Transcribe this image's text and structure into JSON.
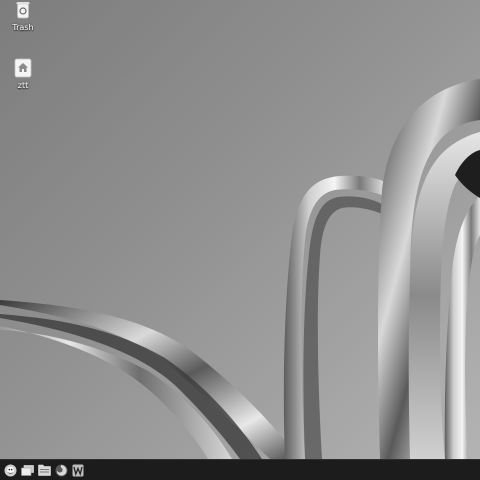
{
  "desktop": {
    "icons": [
      {
        "label": "Trash",
        "icon": "trash-icon"
      },
      {
        "label": "ztt",
        "icon": "home-folder-icon"
      }
    ]
  },
  "taskbar": {
    "buttons": [
      {
        "icon": "start-menu-icon"
      },
      {
        "icon": "show-desktop-icon"
      },
      {
        "icon": "file-manager-icon"
      },
      {
        "icon": "firefox-icon"
      },
      {
        "icon": "wps-writer-icon"
      }
    ]
  },
  "colors": {
    "taskbar_bg": "#1c1c1c",
    "desktop_bg": "#8c8c8c",
    "label_color": "#ffffff"
  }
}
